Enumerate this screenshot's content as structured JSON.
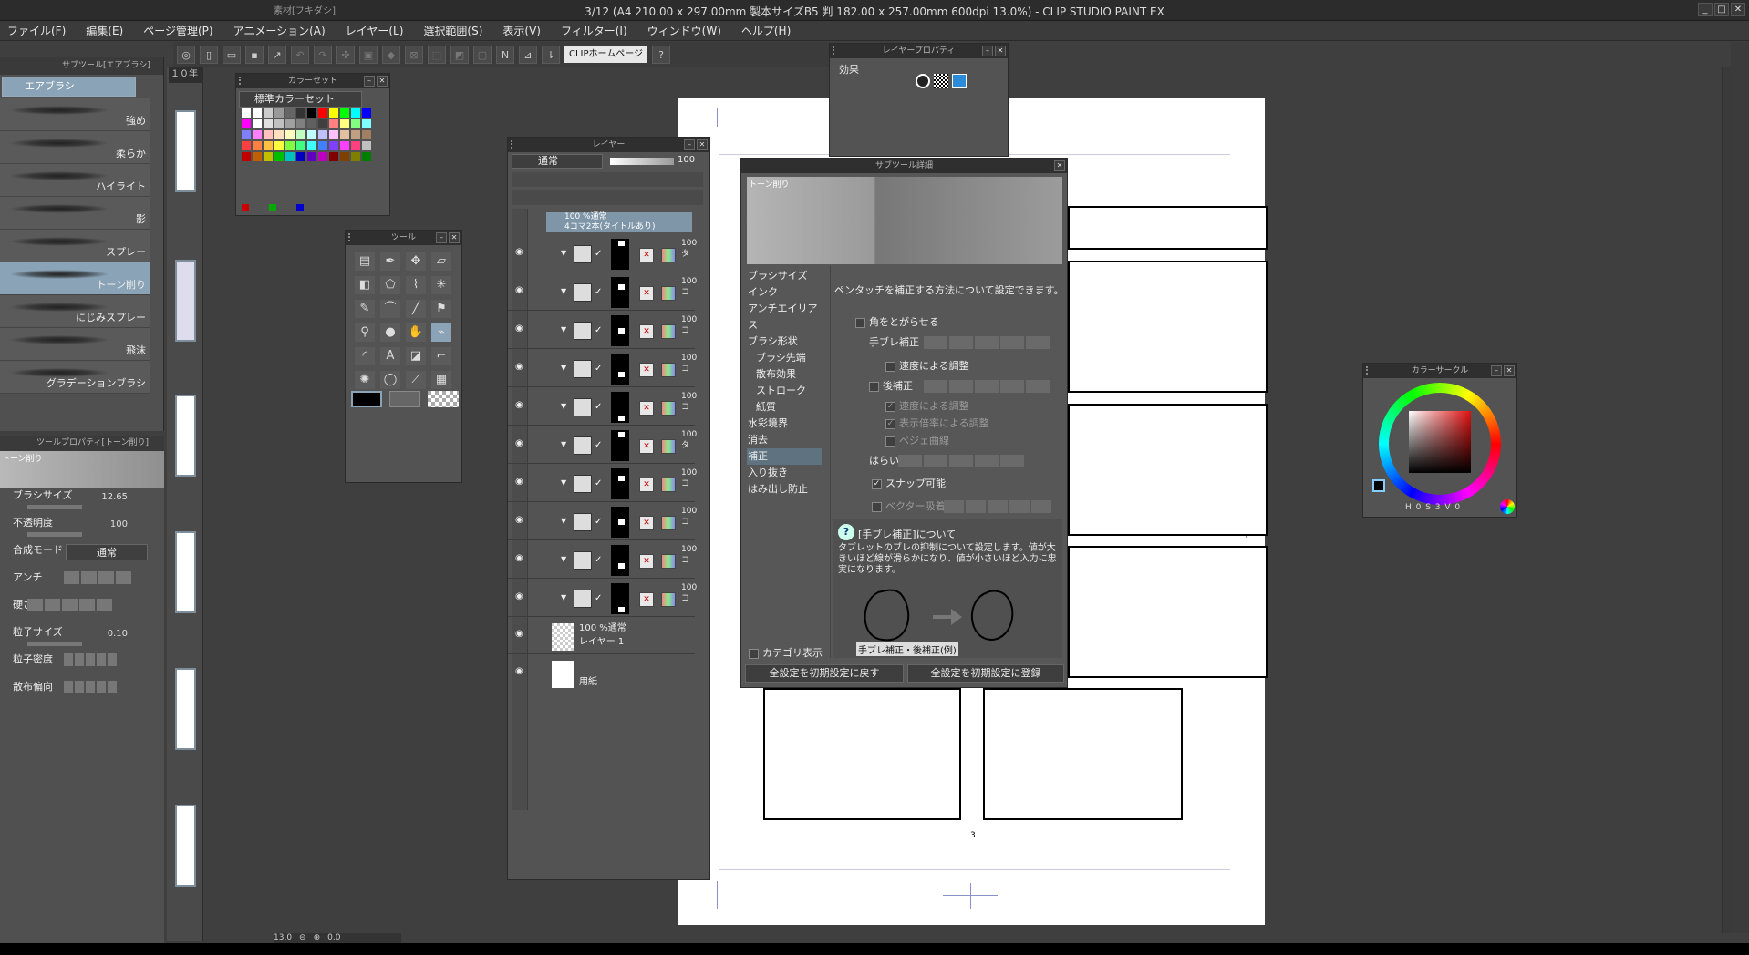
{
  "window": {
    "title": "3/12 (A4 210.00 x 297.00mm 製本サイズB5 判 182.00 x 257.00mm 600dpi 13.0%) - CLIP STUDIO PAINT EX",
    "doc_tab": "素材[フキダシ]"
  },
  "menu": [
    "ファイル(F)",
    "編集(E)",
    "ページ管理(P)",
    "アニメーション(A)",
    "レイヤー(L)",
    "選択範囲(S)",
    "表示(V)",
    "フィルター(I)",
    "ウィンドウ(W)",
    "ヘルプ(H)"
  ],
  "toolbar": {
    "clip_link": "CLIPホームページ"
  },
  "subtool": {
    "title": "サブツール[エアブラシ]",
    "group": "エアブラシ",
    "items": [
      "強め",
      "柔らか",
      "ハイライト",
      "影",
      "スプレー",
      "トーン削り",
      "にじみスプレー",
      "飛沫",
      "グラデーションブラシ"
    ]
  },
  "tool_property": {
    "title": "ツールプロパティ[トーン削り]",
    "preview_label": "トーン削り",
    "brush_size_label": "ブラシサイズ",
    "brush_size": "12.65",
    "opacity_label": "不透明度",
    "opacity": "100",
    "blend_label": "合成モード",
    "blend_value": "通常",
    "antialias_label": "アンチ",
    "hardness_label": "硬さ",
    "particle_size_label": "粒子サイズ",
    "particle_size": "0.10",
    "particle_density_label": "粒子密度",
    "scatter_label": "散布偏向"
  },
  "pages_label": "１０年",
  "color_set": {
    "title": "カラーセット",
    "name": "標準カラーセット",
    "colors": [
      "#ffffff",
      "#ffffff",
      "#cccccc",
      "#999999",
      "#666666",
      "#333333",
      "#000000",
      "#ff0000",
      "#ffff00",
      "#00ff00",
      "#00ffff",
      "#0000ff",
      "#ff00ff",
      "#ffffff",
      "#e0e0e0",
      "#c0c0c0",
      "#a0a0a0",
      "#808080",
      "#606060",
      "#404040",
      "#ff8080",
      "#ffff80",
      "#80ff80",
      "#80ffff",
      "#8080ff",
      "#ff80ff",
      "#ffc0c0",
      "#ffe0c0",
      "#ffffc0",
      "#c0ffc0",
      "#c0ffff",
      "#c0c0ff",
      "#ffc0ff",
      "#e0c0a0",
      "#c0a080",
      "#a08060",
      "#ff4040",
      "#ff8040",
      "#ffc040",
      "#ffff40",
      "#80ff40",
      "#40ff80",
      "#40ffff",
      "#4080ff",
      "#8040ff",
      "#ff40ff",
      "#ff4080",
      "#c0c0c0",
      "#c00000",
      "#c06000",
      "#c0c000",
      "#00c000",
      "#00c0c0",
      "#0000c0",
      "#6000c0",
      "#c000c0",
      "#800000",
      "#804000",
      "#808000",
      "#008000"
    ]
  },
  "tool_palette": {
    "title": "ツール"
  },
  "layer_panel": {
    "title": "レイヤー",
    "blend": "通常",
    "opacity": "100",
    "folder_line1": "100 %通常",
    "folder_line2": "4コマ2本(タイトルあり)",
    "frame_layers": [
      {
        "pct": "100",
        "sub": "タ"
      },
      {
        "pct": "100",
        "sub": "コ"
      },
      {
        "pct": "100",
        "sub": "コ"
      },
      {
        "pct": "100",
        "sub": "コ"
      },
      {
        "pct": "100",
        "sub": "コ"
      },
      {
        "pct": "100",
        "sub": "タ"
      },
      {
        "pct": "100",
        "sub": "コ"
      },
      {
        "pct": "100",
        "sub": "コ"
      },
      {
        "pct": "100",
        "sub": "コ"
      },
      {
        "pct": "100",
        "sub": "コ"
      }
    ],
    "layer1_line1": "100 %通常",
    "layer1_line2": "レイヤー 1",
    "paper": "用紙"
  },
  "layer_property": {
    "title": "レイヤープロパティ",
    "effect_label": "効果"
  },
  "subtool_detail": {
    "title": "サブツール詳細",
    "preview_label": "トーン削り",
    "description": "ペンタッチを補正する方法について設定できます。",
    "categories": [
      {
        "label": "ブラシサイズ",
        "indent": false,
        "active": false
      },
      {
        "label": "インク",
        "indent": false,
        "active": false
      },
      {
        "label": "アンチエイリアス",
        "indent": false,
        "active": false
      },
      {
        "label": "ブラシ形状",
        "indent": false,
        "active": false
      },
      {
        "label": "ブラシ先端",
        "indent": true,
        "active": false
      },
      {
        "label": "散布効果",
        "indent": true,
        "active": false
      },
      {
        "label": "ストローク",
        "indent": true,
        "active": false
      },
      {
        "label": "紙質",
        "indent": true,
        "active": false
      },
      {
        "label": "水彩境界",
        "indent": false,
        "active": false
      },
      {
        "label": "消去",
        "indent": false,
        "active": false
      },
      {
        "label": "補正",
        "indent": false,
        "active": true
      },
      {
        "label": "入り抜き",
        "indent": false,
        "active": false
      },
      {
        "label": "はみ出し防止",
        "indent": false,
        "active": false
      }
    ],
    "opt_sharpen": "角をとがらせる",
    "opt_stabilize": "手ブレ補正",
    "opt_speed": "速度による調整",
    "opt_post": "後補正",
    "opt_speed2": "速度による調整",
    "opt_zoom": "表示倍率による調整",
    "opt_bezier": "ベジェ曲線",
    "opt_harai": "はらい",
    "opt_snap": "スナップ可能",
    "opt_vector": "ベクター吸着",
    "help_title": "[手ブレ補正]について",
    "help_text": "タブレットのブレの抑制について設定します。値が大きいほど線が滑らかになり、値が小さいほど入力に忠実になります。",
    "example_caption": "手ブレ補正・後補正(例)",
    "category_display": "カテゴリ表示",
    "reset_button": "全設定を初期設定に戻す",
    "register_button": "全設定を初期設定に登録"
  },
  "color_circle": {
    "title": "カラーサークル",
    "readout": "H 0 S 3 V 0"
  },
  "canvas": {
    "page_number": "3",
    "zoom": "13.0",
    "rotation": "0.0"
  }
}
